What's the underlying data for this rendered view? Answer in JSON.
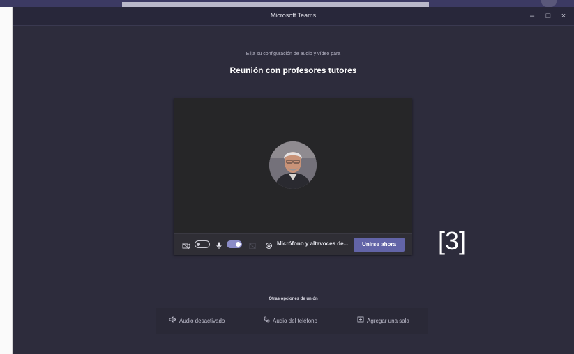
{
  "window": {
    "title": "Microsoft Teams",
    "controls": {
      "minimize": "–",
      "maximize": "□",
      "close": "×"
    }
  },
  "prejoin": {
    "subtitle": "Elija su configuración de audio y vídeo para",
    "meeting_title": "Reunión con profesores tutores",
    "camera_toggle": {
      "state": "off"
    },
    "mic_toggle": {
      "state": "on"
    },
    "device_label": "Micrófono y altavoces de...",
    "join_button": "Unirse ahora"
  },
  "annotation": "[3]",
  "other_options": {
    "title": "Otras opciones de unión",
    "items": [
      {
        "label": "Audio desactivado",
        "icon": "speaker-off-icon"
      },
      {
        "label": "Audio del teléfono",
        "icon": "phone-icon"
      },
      {
        "label": "Agregar una sala",
        "icon": "room-icon"
      }
    ]
  },
  "colors": {
    "background": "#2d2c3c",
    "accent": "#6264a7",
    "toggle_on": "#8b8cc7"
  }
}
